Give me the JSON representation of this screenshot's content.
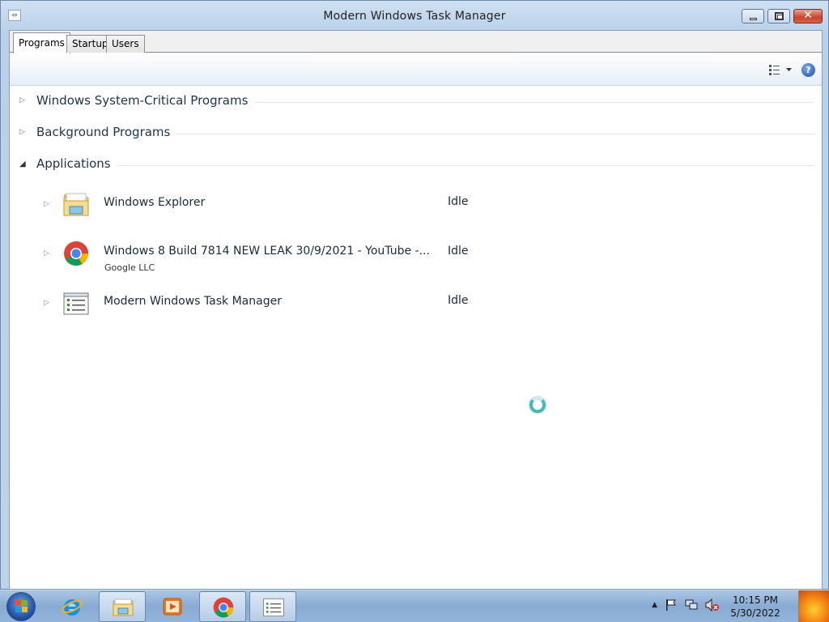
{
  "window": {
    "title": "Modern Windows Task Manager",
    "close_symbol": "✕"
  },
  "tabs": [
    {
      "label": "Programs",
      "active": true
    },
    {
      "label": "Startup",
      "active": false
    },
    {
      "label": "Users",
      "active": false
    }
  ],
  "toolbar": {
    "view_icon": "details-view-icon",
    "help_label": "?"
  },
  "groups": [
    {
      "label": "Windows System-Critical Programs",
      "expanded": false
    },
    {
      "label": "Background Programs",
      "expanded": false
    },
    {
      "label": "Applications",
      "expanded": true
    }
  ],
  "applications": [
    {
      "name": "Windows Explorer",
      "publisher": "",
      "status": "Idle",
      "icon": "folder-icon"
    },
    {
      "name": "Windows 8 Build 7814 NEW LEAK 30/9/2021 - YouTube -...",
      "publisher": "Google LLC",
      "status": "Idle",
      "icon": "chrome-icon"
    },
    {
      "name": "Modern Windows Task Manager",
      "publisher": "",
      "status": "Idle",
      "icon": "task-manager-icon"
    }
  ],
  "taskbar": {
    "items": [
      "ie-icon",
      "explorer-icon",
      "media-player-icon",
      "chrome-icon",
      "task-manager-icon"
    ],
    "tray": {
      "show_hidden": "▲",
      "flag_icon": "action-center-flag-icon",
      "network_icon": "network-icon",
      "volume_icon": "volume-muted-icon"
    },
    "clock": {
      "time": "10:15 PM",
      "date": "5/30/2022"
    }
  },
  "colors": {
    "accent": "#1e4fa8",
    "titlebar": "#bcd3ec",
    "close": "#c8442d"
  }
}
